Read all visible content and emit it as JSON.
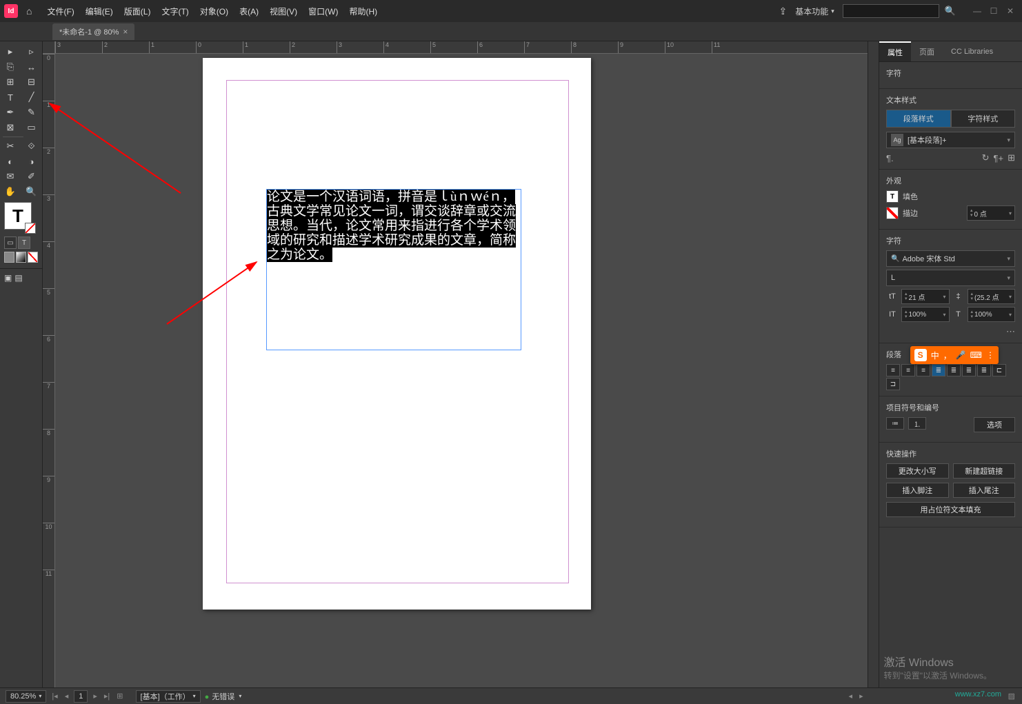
{
  "app": {
    "id_label": "Id"
  },
  "menu": {
    "file": "文件(F)",
    "edit": "编辑(E)",
    "layout": "版面(L)",
    "type": "文字(T)",
    "object": "对象(O)",
    "table": "表(A)",
    "view": "视图(V)",
    "window": "窗口(W)",
    "help": "帮助(H)"
  },
  "workspace": {
    "label": "基本功能"
  },
  "tab": {
    "title": "*未命名-1 @ 80%",
    "close": "×"
  },
  "ruler_h": [
    "3",
    "2",
    "1",
    "0",
    "1",
    "2",
    "3",
    "4",
    "5",
    "6",
    "7",
    "8",
    "9",
    "10",
    "11"
  ],
  "ruler_v": [
    "0",
    "1",
    "2",
    "3",
    "4",
    "5",
    "6",
    "7",
    "8",
    "9",
    "10",
    "11"
  ],
  "document_text": "论文是一个汉语词语，拼音是ｌùｎｗéｎ，古典文学常见论文一词，谓交谈辞章或交流思想。当代，论文常用来指进行各个学术领域的研究和描述学术研究成果的文章，简称之为论文。",
  "right_panel": {
    "tabs": {
      "properties": "属性",
      "pages": "页面",
      "cc": "CC Libraries"
    },
    "char_section": "字符",
    "text_styles": "文本样式",
    "para_style_tab": "段落样式",
    "char_style_tab": "字符样式",
    "style_name": "[基本段落]+",
    "appearance": "外观",
    "fill_label": "填色",
    "stroke_label": "描边",
    "stroke_value": "0 点",
    "font_family": "Adobe 宋体 Std",
    "font_style": "L",
    "font_size": "21 点",
    "leading": "(25.2 点",
    "vscale": "100%",
    "hscale": "100%",
    "paragraph": "段落",
    "bullets": "项目符号和编号",
    "options": "选项",
    "quick": "快速操作",
    "change_case": "更改大小写",
    "new_link": "新建超链接",
    "insert_footnote": "插入脚注",
    "insert_endnote": "插入尾注",
    "placeholder_fill": "用占位符文本填充"
  },
  "statusbar": {
    "zoom": "80.25%",
    "page": "1",
    "preflight_profile": "[基本]（工作）",
    "errors": "无错误"
  },
  "overlay": {
    "activate_title": "激活 Windows",
    "activate_sub": "转到\"设置\"以激活 Windows。",
    "ime_lang": "中",
    "watermark": "www.xz7.com"
  }
}
